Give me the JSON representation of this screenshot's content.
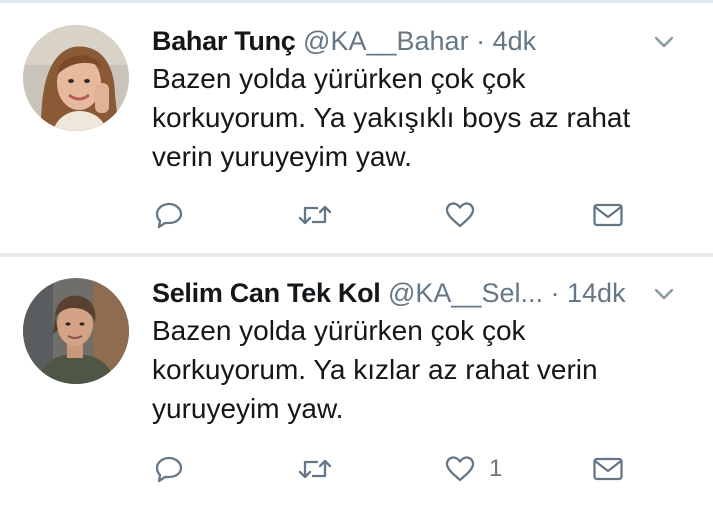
{
  "tweets": [
    {
      "name": "Bahar Tunç",
      "handle": "@KA__Bahar",
      "separator": "·",
      "time": "4dk",
      "text_lines": [
        "Bazen yolda yürürken çok çok",
        "korkuyorum. Ya yakışıklı boys az rahat",
        "verin yuruyeyim yaw."
      ],
      "like_count": ""
    },
    {
      "name": "Selim Can Tek Kol",
      "handle": "@KA__Sel...",
      "separator": "·",
      "time": "14dk",
      "text_lines": [
        "Bazen yolda yürürken çok çok",
        "korkuyorum. Ya kızlar az rahat verin",
        "yuruyeyim yaw."
      ],
      "like_count": "1"
    }
  ],
  "icons": {
    "reply": "reply-icon",
    "retweet": "retweet-icon",
    "like": "heart-icon",
    "dm": "envelope-icon",
    "menu": "chevron-down-icon"
  },
  "colors": {
    "text": "#14171a",
    "secondary": "#657786",
    "icon": "#657786",
    "divider": "#e6ecf0"
  }
}
